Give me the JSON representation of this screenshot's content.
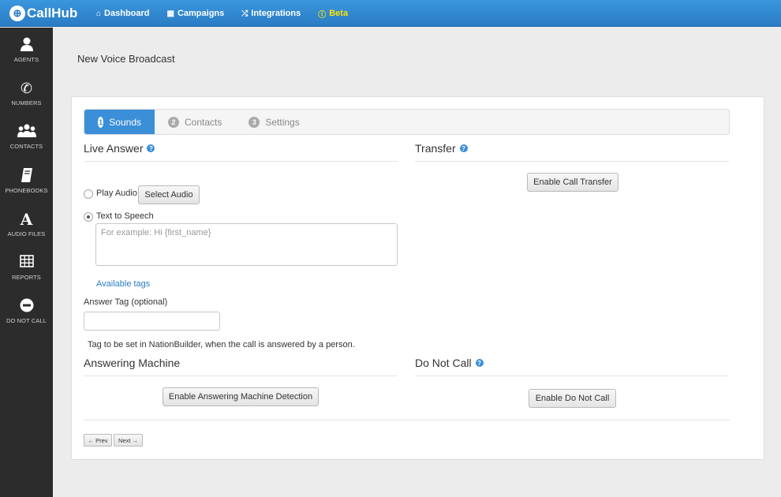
{
  "app": {
    "logo_glyph": "⊕",
    "name": "CallHub"
  },
  "topnav": [
    {
      "icon": "home-icon",
      "glyph": "⌂",
      "label": "Dashboard"
    },
    {
      "icon": "grid-icon",
      "glyph": "▦",
      "label": "Campaigns"
    },
    {
      "icon": "shuffle-icon",
      "glyph": "⤮",
      "label": "Integrations"
    },
    {
      "icon": "info-icon",
      "glyph": "ⓘ",
      "label": "Beta"
    }
  ],
  "sidebar": [
    {
      "icon": "user-icon",
      "glyph": "●",
      "label": "AGENTS"
    },
    {
      "icon": "phone-icon",
      "glyph": "✆",
      "label": "NUMBERS"
    },
    {
      "icon": "group-icon",
      "glyph": "⚉",
      "label": "CONTACTS"
    },
    {
      "icon": "book-icon",
      "glyph": "▤",
      "label": "PHONEBOOKS"
    },
    {
      "icon": "font-icon",
      "glyph": "A",
      "label": "AUDIO FILES"
    },
    {
      "icon": "table-icon",
      "glyph": "▦",
      "label": "REPORTS"
    },
    {
      "icon": "minus-circle-icon",
      "glyph": "⊖",
      "label": "DO NOT CALL"
    }
  ],
  "page_title": "New Voice Broadcast",
  "tabs": [
    {
      "num": "1",
      "label": "Sounds",
      "active": true
    },
    {
      "num": "2",
      "label": "Contacts",
      "active": false
    },
    {
      "num": "3",
      "label": "Settings",
      "active": false
    }
  ],
  "live_answer": {
    "title": "Live Answer",
    "play_audio_label": "Play Audio",
    "select_audio_button": "Select Audio",
    "tts_label": "Text to Speech",
    "tts_placeholder": "For example: Hi {first_name}",
    "tts_value": "",
    "available_tags_link": "Available tags",
    "answer_tag_label": "Answer Tag (optional)",
    "answer_tag_value": "",
    "answer_tag_help": "Tag to be set in NationBuilder, when the call is answered by a person.",
    "selected_option": "Text to Speech"
  },
  "transfer": {
    "title": "Transfer",
    "button": "Enable Call Transfer"
  },
  "answering_machine": {
    "title": "Answering Machine",
    "button": "Enable Answering Machine Detection"
  },
  "do_not_call": {
    "title": "Do Not Call",
    "button": "Enable Do Not Call"
  },
  "pager": {
    "prev": "← Prev",
    "next": "Next →"
  },
  "help_glyph": "?"
}
